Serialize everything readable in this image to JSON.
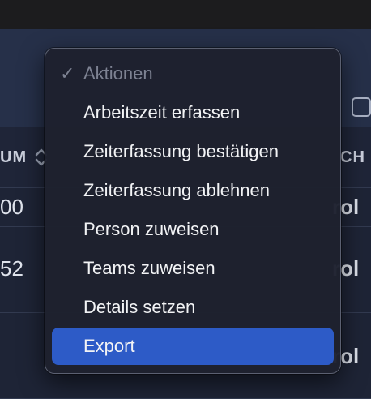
{
  "background": {
    "table_header_left": "UM",
    "table_header_right": "CH",
    "row1_left": "00",
    "row1_right": "rol",
    "row2_left": "52",
    "row2_right": "rol",
    "row3_right": "rol"
  },
  "menu": {
    "header": {
      "label": "Aktionen",
      "checked": true
    },
    "items": [
      {
        "label": "Arbeitszeit erfassen"
      },
      {
        "label": "Zeiterfassung bestätigen"
      },
      {
        "label": "Zeiterfassung ablehnen"
      },
      {
        "label": "Person zuweisen"
      },
      {
        "label": "Teams zuweisen"
      },
      {
        "label": "Details setzen"
      },
      {
        "label": "Export",
        "selected": true
      }
    ]
  },
  "colors": {
    "selected": "#2d5bc7",
    "menu_bg": "#1e212e",
    "page_bg": "#1f2433"
  }
}
